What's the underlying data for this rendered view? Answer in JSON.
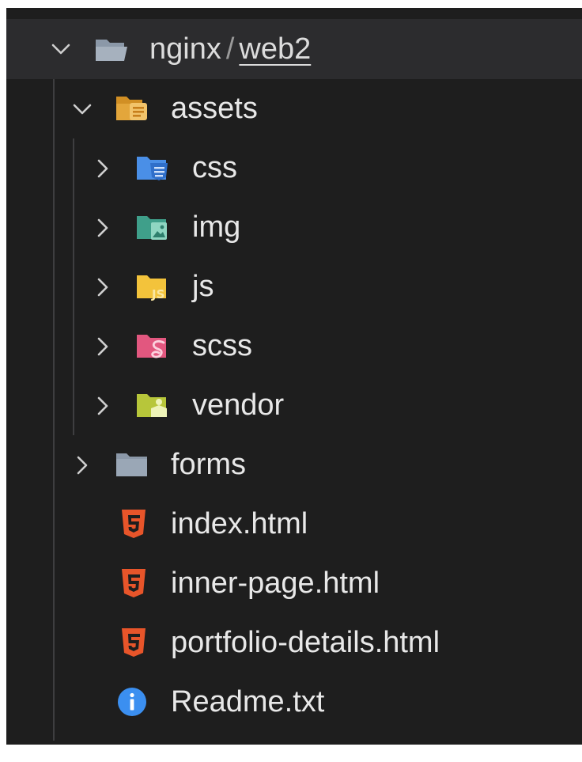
{
  "explorer": {
    "root": {
      "folder": "nginx",
      "separator": "/",
      "subfolder": "web2",
      "expanded": true,
      "icon": "folder-open-icon"
    },
    "assets": {
      "label": "assets",
      "expanded": true,
      "icon": "folder-assets-open-icon",
      "children": [
        {
          "label": "css",
          "icon": "folder-css-icon",
          "color": "#4a8fe7"
        },
        {
          "label": "img",
          "icon": "folder-img-icon",
          "color": "#3f9f8a"
        },
        {
          "label": "js",
          "icon": "folder-js-icon",
          "color": "#f3c33b"
        },
        {
          "label": "scss",
          "icon": "folder-scss-icon",
          "color": "#e2577f"
        },
        {
          "label": "vendor",
          "icon": "folder-vendor-icon",
          "color": "#b7c63a"
        }
      ]
    },
    "forms": {
      "label": "forms",
      "expanded": false,
      "icon": "folder-icon",
      "color": "#8b98a8"
    },
    "files": [
      {
        "label": "index.html",
        "icon": "html5-icon"
      },
      {
        "label": "inner-page.html",
        "icon": "html5-icon"
      },
      {
        "label": "portfolio-details.html",
        "icon": "html5-icon"
      },
      {
        "label": "Readme.txt",
        "icon": "info-icon"
      }
    ]
  },
  "colors": {
    "background": "#1e1e1e",
    "header": "#2c2c2e",
    "text": "#e8e8e8",
    "html5": "#e8552a",
    "info": "#3b8ff0",
    "assets_folder": "#e3a63b"
  }
}
